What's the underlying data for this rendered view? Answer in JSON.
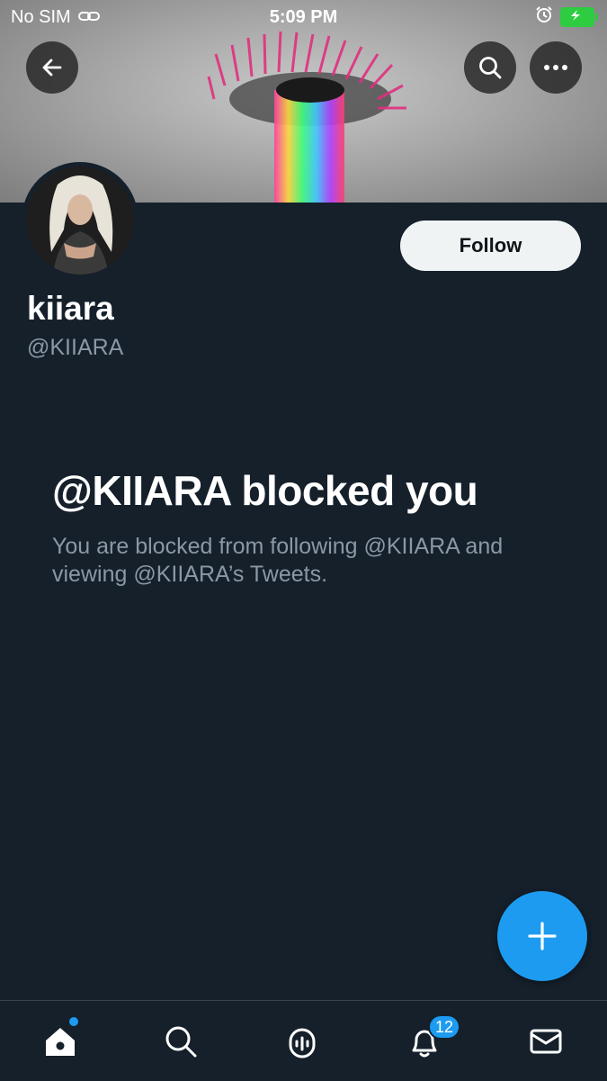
{
  "status_bar": {
    "carrier": "No SIM",
    "time": "5:09 PM"
  },
  "profile": {
    "display_name": "kiiara",
    "handle": "@KIIARA",
    "follow_label": "Follow"
  },
  "blocked": {
    "title": "@KIIARA blocked you",
    "description": "You are blocked from following @KIIARA and viewing @KIIARA’s Tweets."
  },
  "tab_bar": {
    "items": [
      {
        "icon": "home-icon",
        "active": true
      },
      {
        "icon": "search-icon"
      },
      {
        "icon": "spaces-icon"
      },
      {
        "icon": "notifications-icon"
      },
      {
        "icon": "messages-icon"
      }
    ],
    "notifications_badge": "12"
  },
  "colors": {
    "background": "#15202b",
    "accent": "#1d9bf0",
    "secondary_text": "#8b98a5",
    "battery": "#2ecc40"
  }
}
